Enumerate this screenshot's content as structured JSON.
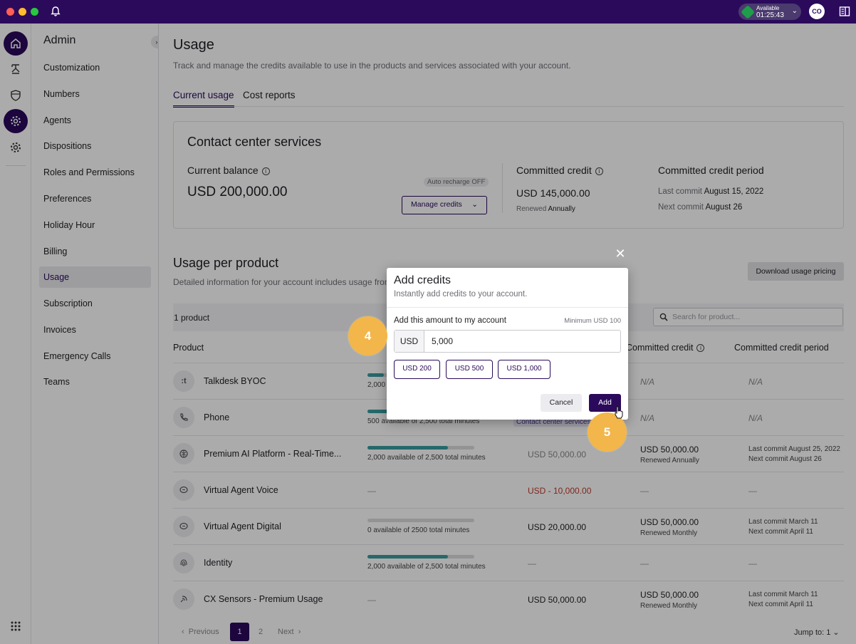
{
  "topbar": {
    "status_label": "Available",
    "status_timer": "01:25:43",
    "avatar_initials": "CO",
    "colors": {
      "bar": "#2b0a5c",
      "status_green": "#1e9e4a"
    }
  },
  "admin_nav": {
    "title": "Admin",
    "items": [
      "Customization",
      "Numbers",
      "Agents",
      "Dispositions",
      "Roles and Permissions",
      "Preferences",
      "Holiday Hour",
      "Billing",
      "Usage",
      "Subscription",
      "Invoices",
      "Emergency Calls",
      "Teams"
    ],
    "active": "Usage"
  },
  "page": {
    "title": "Usage",
    "subtitle": "Track and manage the credits available to use in the products and services associated with your account.",
    "tabs": [
      "Current usage",
      "Cost reports"
    ]
  },
  "card": {
    "title": "Contact center services",
    "balance_label": "Current balance",
    "balance_value": "USD 200,000.00",
    "auto_recharge": "Auto recharge OFF",
    "manage_button": "Manage credits",
    "committed_label": "Committed credit",
    "committed_value": "USD 145,000.00",
    "renewed_prefix": "Renewed",
    "renewed_value": "Annually",
    "period_label": "Committed credit period",
    "last_commit_prefix": "Last commit",
    "last_commit_date": "August 15, 2022",
    "next_commit_prefix": "Next commit",
    "next_commit_date": "August 26"
  },
  "usage": {
    "title": "Usage per product",
    "subtitle": "Detailed information for your account includes usage from",
    "download_button": "Download usage pricing",
    "count": "1 product",
    "search_placeholder": "Search for product...",
    "headers": {
      "product": "Product",
      "committed": "Committed credit",
      "period": "Committed credit period"
    },
    "rows": [
      {
        "name": "Talkdesk BYOC",
        "usage_text": "2,000",
        "fill": 0.15,
        "committed": "N/A",
        "period": "N/A"
      },
      {
        "name": "Phone",
        "usage_text": "500 available of 2,500 total minutes",
        "fill": 0.2,
        "tag": "Contact center services",
        "committed": "N/A",
        "period": "N/A"
      },
      {
        "name": "Premium AI Platform - Real-Time...",
        "usage_text": "2,000 available of 2,500 total minutes",
        "fill": 0.75,
        "balance": "USD 50,000.00",
        "committed": "USD 50,000.00",
        "committed_sub": "Renewed Annually",
        "last_commit": "Last commit  August 25, 2022",
        "next_commit": "Next commit  August 26"
      },
      {
        "name": "Virtual Agent Voice",
        "usage_text": "—",
        "balance": "USD - 10,000.00",
        "committed": "—",
        "period": "—"
      },
      {
        "name": "Virtual Agent Digital",
        "usage_text": "0 available of 2500 total minutes",
        "fill": 0,
        "balance": "USD 20,000.00",
        "committed": "USD 50,000.00",
        "committed_sub": "Renewed Monthly",
        "last_commit": "Last commit  March 11",
        "next_commit": "Next commit  April 11"
      },
      {
        "name": "Identity",
        "usage_text": "2,000 available of 2,500 total minutes",
        "fill": 0.75,
        "balance": "—",
        "committed": "—",
        "period": "—"
      },
      {
        "name": "CX Sensors - Premium Usage",
        "usage_text": "—",
        "balance": "USD 50,000.00",
        "committed": "USD 50,000.00",
        "committed_sub": "Renewed Monthly",
        "last_commit": "Last commit  March 11",
        "next_commit": "Next commit  April 11"
      }
    ]
  },
  "pager": {
    "previous": "Previous",
    "page1": "1",
    "page2": "2",
    "next": "Next",
    "jump_label": "Jump to:",
    "jump_value": "1"
  },
  "modal": {
    "title": "Add credits",
    "subtitle": "Instantly add credits to your account.",
    "amount_label": "Add this amount to my account",
    "minimum": "Minimum USD 100",
    "currency": "USD",
    "value": "5,000",
    "presets": [
      "USD 200",
      "USD 500",
      "USD 1,000"
    ],
    "cancel": "Cancel",
    "add": "Add"
  },
  "steps": {
    "step4": "4",
    "step5": "5"
  }
}
